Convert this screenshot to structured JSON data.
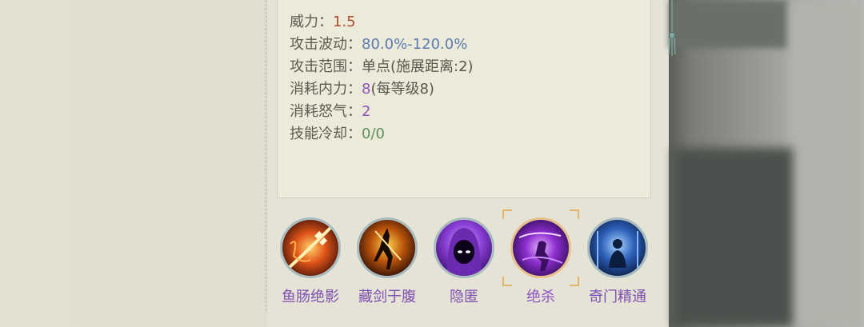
{
  "attributes": [
    {
      "label": "威力：",
      "value": "1.5",
      "tone": "red"
    },
    {
      "label": "攻击波动：",
      "value": "80.0%-120.0%",
      "tone": "blue"
    },
    {
      "label": "攻击范围：",
      "value": "单点(施展距离:2)",
      "tone": "dark"
    },
    {
      "label": "消耗内力：",
      "value": "8",
      "suffix": "(每等级8)",
      "tone": "purple"
    },
    {
      "label": "消耗怒气：",
      "value": "2",
      "tone": "purple"
    },
    {
      "label": "技能冷却：",
      "value": "0/0",
      "tone": "green"
    }
  ],
  "skills": [
    {
      "name": "鱼肠绝影",
      "icon": "fiery-blade-icon",
      "selected": false
    },
    {
      "name": "藏剑于腹",
      "icon": "flaming-warrior-icon",
      "selected": false
    },
    {
      "name": "隐匿",
      "icon": "hooded-figure-icon",
      "selected": false
    },
    {
      "name": "绝杀",
      "icon": "shadow-strike-icon",
      "selected": true
    },
    {
      "name": "奇门精通",
      "icon": "blue-meditation-icon",
      "selected": false
    }
  ],
  "colors": {
    "accent_purple": "#8c55b8",
    "value_red": "#b04a33",
    "value_blue": "#5c7bb0",
    "value_green": "#5f8e62",
    "selection_gold": "#e6b36a"
  }
}
